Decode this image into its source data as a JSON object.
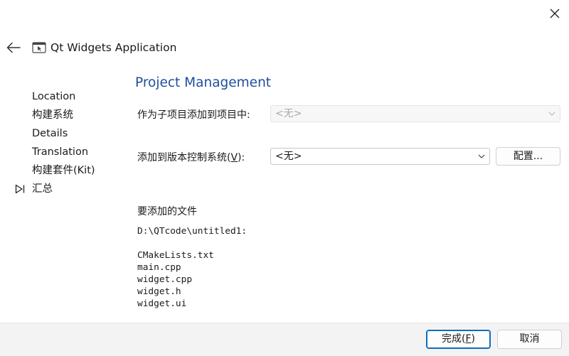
{
  "dialog": {
    "title": "Qt Widgets Application"
  },
  "sidebar": {
    "steps": [
      {
        "label": "Location"
      },
      {
        "label": "构建系统"
      },
      {
        "label": "Details"
      },
      {
        "label": "Translation"
      },
      {
        "label": "构建套件(Kit)"
      },
      {
        "label": "汇总",
        "current": true
      }
    ]
  },
  "page": {
    "title": "Project Management",
    "subproject": {
      "label": "作为子项目添加到项目中:",
      "value": "<无>",
      "enabled": false
    },
    "vcs": {
      "label_prefix": "添加到版本控制系统(",
      "label_mnemonic": "V",
      "label_suffix": "):",
      "value": "<无>",
      "configure_label": "配置..."
    },
    "files": {
      "heading": "要添加的文件",
      "directory": "D:\\QTcode\\untitled1:",
      "list": [
        "CMakeLists.txt",
        "main.cpp",
        "widget.cpp",
        "widget.h",
        "widget.ui"
      ]
    }
  },
  "footer": {
    "finish_prefix": "完成(",
    "finish_mnemonic": "F",
    "finish_suffix": ")",
    "cancel_label": "取消"
  },
  "colors": {
    "title_accent": "#1f4e9e",
    "primary_border": "#0f6cbd"
  }
}
